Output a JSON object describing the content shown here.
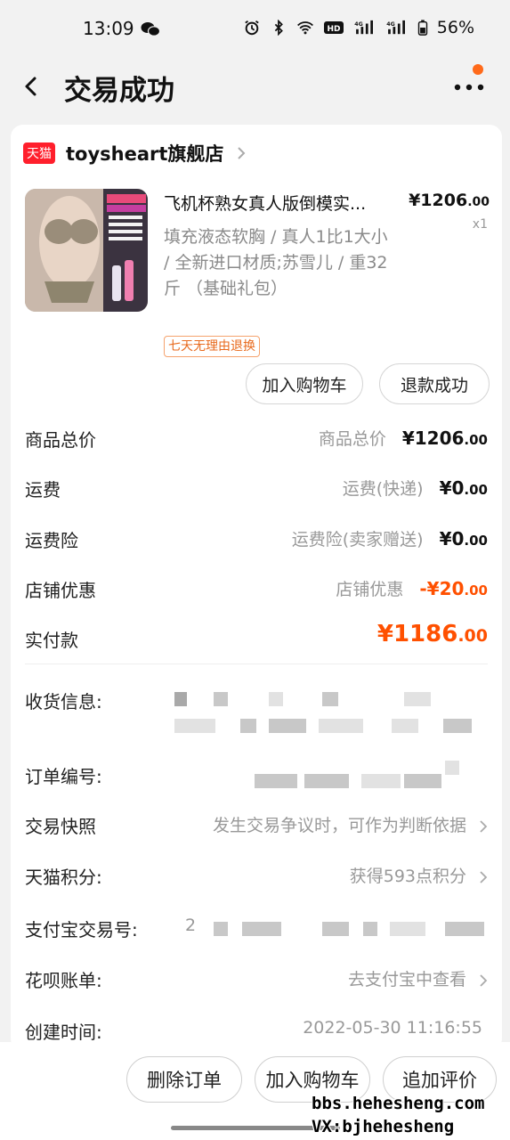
{
  "status_bar": {
    "time": "13:09",
    "battery": "56%",
    "icons": [
      "wechat-icon",
      "alarm-icon",
      "bluetooth-icon",
      "wifi-icon",
      "hd-icon",
      "signal-4g-icon",
      "signal-4g-icon",
      "battery-icon"
    ]
  },
  "nav": {
    "title": "交易成功",
    "back_icon": "chevron-left-icon",
    "more_icon": "more-dots-icon",
    "accent": "#ff6a1a"
  },
  "shop": {
    "badge": "天猫",
    "name": "toysheart旗舰店",
    "badge_color": "#ff1f2c"
  },
  "product": {
    "title": "飞机杯熟女真人版倒模实...",
    "spec": "填充液态软胸 / 真人1比1大小 / 全新进口材质;苏雪儿  /  重32斤    （基础礼包）",
    "price_int": "¥1206",
    "price_dec": ".00",
    "qty": "x1",
    "tag": "七天无理由退换",
    "add_cart": "加入购物车",
    "refund_status": "退款成功"
  },
  "costs": {
    "goods_total_label": "商品总价",
    "goods_total_hint": "商品总价",
    "goods_total_int": "¥1206",
    "goods_total_dec": ".00",
    "shipping_label": "运费",
    "shipping_hint": "运费(快递)",
    "shipping_int": "¥0",
    "shipping_dec": ".00",
    "insurance_label": "运费险",
    "insurance_hint": "运费险(卖家赠送)",
    "insurance_int": "¥0",
    "insurance_dec": ".00",
    "discount_label": "店铺优惠",
    "discount_hint": "店铺优惠",
    "discount_int": "-¥20",
    "discount_dec": ".00",
    "paid_label": "实付款",
    "paid_int": "¥1186",
    "paid_dec": ".00",
    "price_color": "#ff5000"
  },
  "details": {
    "shipping_info_label": "收货信息:",
    "order_no_label": "订单编号:",
    "snapshot_label": "交易快照",
    "snapshot_value": "发生交易争议时，可作为判断依据",
    "points_label": "天猫积分:",
    "points_value": "获得593点积分",
    "alipay_label": "支付宝交易号:",
    "alipay_prefix": "2",
    "huabei_label": "花呗账单:",
    "huabei_value": "去支付宝中查看",
    "created_label": "创建时间:",
    "created_value": "2022-05-30 11:16:55"
  },
  "bottom": {
    "delete": "删除订单",
    "add_cart": "加入购物车",
    "review": "追加评价"
  },
  "watermark": {
    "line1": "bbs.hehesheng.com",
    "line2": "VX:bjhehesheng"
  }
}
